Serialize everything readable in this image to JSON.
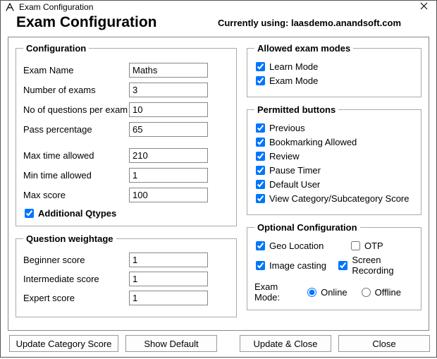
{
  "window": {
    "title": "Exam Configuration"
  },
  "header": {
    "page_title": "Exam Configuration",
    "currently_using": "Currently using: laasdemo.anandsoft.com"
  },
  "configuration": {
    "legend": "Configuration",
    "exam_name": {
      "label": "Exam Name",
      "value": "Maths"
    },
    "number_of_exams": {
      "label": "Number of exams",
      "value": "3"
    },
    "questions_per_exam": {
      "label": "No of questions per exam",
      "value": "10"
    },
    "pass_percentage": {
      "label": "Pass percentage",
      "value": "65"
    },
    "max_time": {
      "label": "Max time allowed",
      "value": "210"
    },
    "min_time": {
      "label": "Min time allowed",
      "value": "1"
    },
    "max_score": {
      "label": "Max score",
      "value": "100"
    },
    "additional_qtypes": {
      "label": "Additional Qtypes",
      "checked": true
    }
  },
  "weightage": {
    "legend": "Question weightage",
    "beginner": {
      "label": "Beginner score",
      "value": "1"
    },
    "intermediate": {
      "label": "Intermediate score",
      "value": "1"
    },
    "expert": {
      "label": "Expert score",
      "value": "1"
    }
  },
  "allowed_modes": {
    "legend": "Allowed exam modes",
    "learn": {
      "label": "Learn Mode",
      "checked": true
    },
    "exam": {
      "label": "Exam Mode",
      "checked": true
    }
  },
  "permitted_buttons": {
    "legend": "Permitted buttons",
    "previous": {
      "label": "Previous",
      "checked": true
    },
    "bookmarking": {
      "label": "Bookmarking Allowed",
      "checked": true
    },
    "review": {
      "label": "Review",
      "checked": true
    },
    "pause_timer": {
      "label": "Pause Timer",
      "checked": true
    },
    "default_user": {
      "label": "Default User",
      "checked": true
    },
    "view_category": {
      "label": "View Category/Subcategory Score",
      "checked": true
    }
  },
  "optional_config": {
    "legend": "Optional Configuration",
    "geo": {
      "label": "Geo Location",
      "checked": true
    },
    "otp": {
      "label": "OTP",
      "checked": false
    },
    "image_casting": {
      "label": "Image casting",
      "checked": true
    },
    "screen_recording": {
      "label": "Screen Recording",
      "checked": true
    },
    "exam_mode": {
      "label": "Exam Mode:",
      "selected": "online",
      "online": "Online",
      "offline": "Offline"
    }
  },
  "buttons": {
    "update_category": "Update Category Score",
    "show_default": "Show Default",
    "update_close": "Update & Close",
    "close": "Close"
  }
}
